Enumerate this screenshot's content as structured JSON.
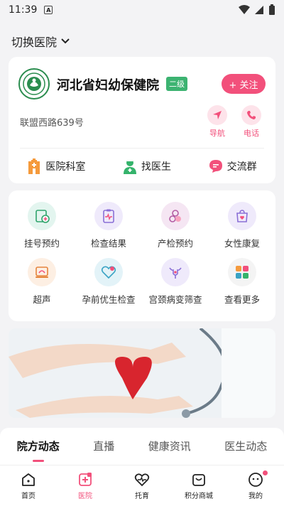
{
  "status": {
    "time": "11:39",
    "notif": "A"
  },
  "header": {
    "switch_label": "切换医院"
  },
  "hospital": {
    "name": "河北省妇幼保健院",
    "level": "二级",
    "follow_label": "+ 关注",
    "address": "联盟西路639号",
    "nav_label": "导航",
    "call_label": "电话",
    "quick_links": [
      {
        "label": "医院科室",
        "icon": "hospital-building-icon"
      },
      {
        "label": "找医生",
        "icon": "doctor-icon"
      },
      {
        "label": "交流群",
        "icon": "chat-bubble-icon"
      }
    ]
  },
  "services": [
    {
      "label": "挂号预约",
      "icon": "appointment-icon",
      "bg": "#e3f5ef"
    },
    {
      "label": "检查结果",
      "icon": "report-icon",
      "bg": "#efeafb"
    },
    {
      "label": "产检预约",
      "icon": "prenatal-icon",
      "bg": "#f5e6f3"
    },
    {
      "label": "女性康复",
      "icon": "rehab-bag-icon",
      "bg": "#efeafb"
    },
    {
      "label": "超声",
      "icon": "ultrasound-icon",
      "bg": "#fdefe3"
    },
    {
      "label": "孕前优生检查",
      "icon": "preconception-icon",
      "bg": "#e3f3f8"
    },
    {
      "label": "宫颈病变筛查",
      "icon": "uterus-icon",
      "bg": "#efeafb"
    },
    {
      "label": "查看更多",
      "icon": "more-grid-icon",
      "bg": "#f4f4f4"
    }
  ],
  "tabs": [
    "院方动态",
    "直播",
    "健康资讯",
    "医生动态"
  ],
  "bottom_nav": [
    {
      "label": "首页",
      "icon": "home-icon"
    },
    {
      "label": "医院",
      "icon": "hospital-icon"
    },
    {
      "label": "托育",
      "icon": "heart-pulse-icon"
    },
    {
      "label": "积分商城",
      "icon": "shop-bag-icon"
    },
    {
      "label": "我的",
      "icon": "profile-face-icon"
    }
  ],
  "colors": {
    "accent": "#f2507b",
    "badge": "#3cb371"
  }
}
